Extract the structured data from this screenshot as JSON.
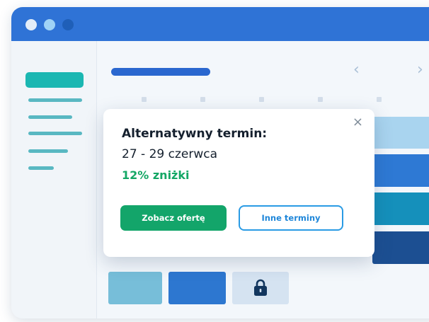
{
  "window": {
    "controls": [
      "window-dot-light",
      "window-dot-sky",
      "window-dot-blue"
    ]
  },
  "calendar": {
    "prev_icon": "‹",
    "next_icon": "›",
    "locked_icon": "lock-icon"
  },
  "popup": {
    "close_icon": "×",
    "title": "Alternatywny termin:",
    "dates": "27 - 29 czerwca",
    "discount": "12% zniżki",
    "primary_button": "Zobacz ofertę",
    "secondary_button": "Inne terminy"
  },
  "colors": {
    "titlebar": "#2f73d6",
    "accent_teal": "#1bb7b2",
    "discount_green": "#14a765",
    "primary_button": "#13a56a",
    "secondary_border": "#2a9be4"
  }
}
